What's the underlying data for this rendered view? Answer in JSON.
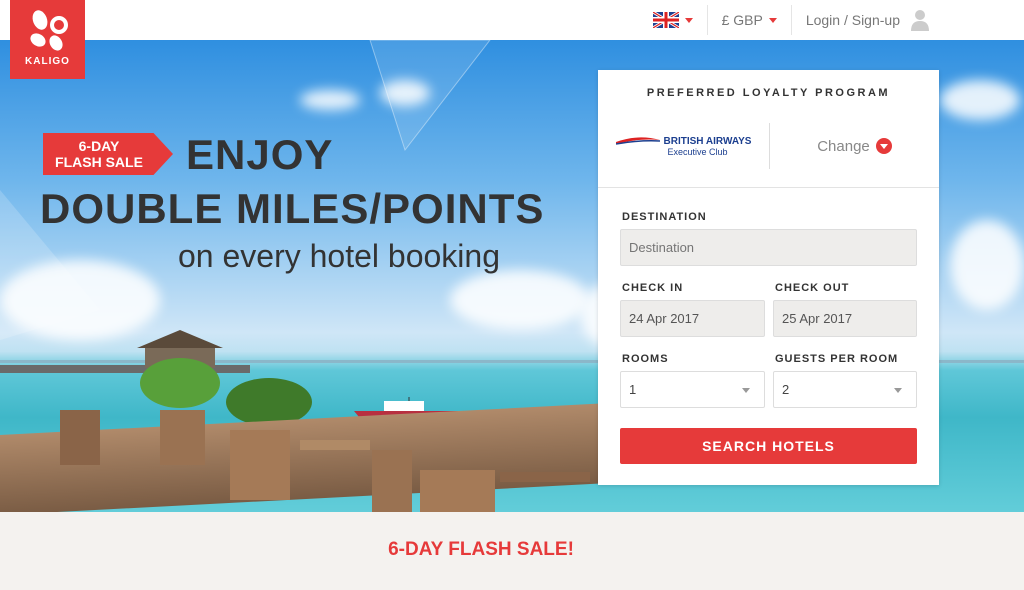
{
  "brand": {
    "name": "KALIGO",
    "accent": "#e63a3a"
  },
  "nav": {
    "language": "en-GB",
    "currency": "£ GBP",
    "login": "Login / Sign-up"
  },
  "hero": {
    "flash_tag_line1": "6-DAY",
    "flash_tag_line2": "FLASH SALE",
    "headline_line1": "ENJOY",
    "headline_line2": "DOUBLE MILES/POINTS",
    "headline_line3": "on every hotel booking"
  },
  "booking": {
    "loyalty_title": "PREFERRED LOYALTY PROGRAM",
    "program_name": "BRITISH AIRWAYS",
    "program_sub": "Executive Club",
    "change_label": "Change",
    "destination_label": "DESTINATION",
    "destination_placeholder": "Destination",
    "checkin_label": "CHECK IN",
    "checkin_value": "24 Apr 2017",
    "checkout_label": "CHECK OUT",
    "checkout_value": "25 Apr 2017",
    "rooms_label": "ROOMS",
    "rooms_value": "1",
    "guests_label": "GUESTS PER ROOM",
    "guests_value": "2",
    "search_label": "SEARCH HOTELS"
  },
  "bottom": {
    "title": "6-DAY FLASH SALE!"
  }
}
